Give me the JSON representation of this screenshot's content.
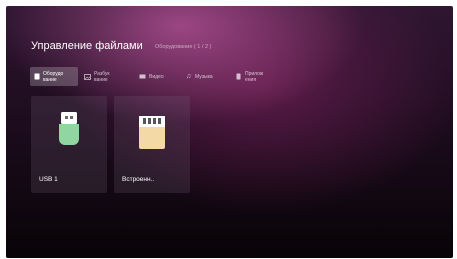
{
  "header": {
    "title": "Управление файлами",
    "subtitle": "Оборудование ( 1 / 2 )"
  },
  "tabs": [
    {
      "lines": [
        "Оборудо",
        "вание"
      ],
      "icon": "device-icon",
      "active": true
    },
    {
      "lines": [
        "Разбук",
        "вание"
      ],
      "icon": "image-icon",
      "active": false
    },
    {
      "lines": [
        "Видео"
      ],
      "icon": "video-icon",
      "active": false
    },
    {
      "lines": [
        "Музыка"
      ],
      "icon": "music-icon",
      "active": false
    },
    {
      "lines": [
        "Прилож",
        "ения"
      ],
      "icon": "phone-icon",
      "active": false
    }
  ],
  "devices": [
    {
      "label": "USB 1",
      "icon": "usb-drive-icon",
      "color": "#8fd6a0"
    },
    {
      "label": "Встроенн..",
      "icon": "sd-card-icon",
      "color": "#f2d9a6"
    }
  ]
}
